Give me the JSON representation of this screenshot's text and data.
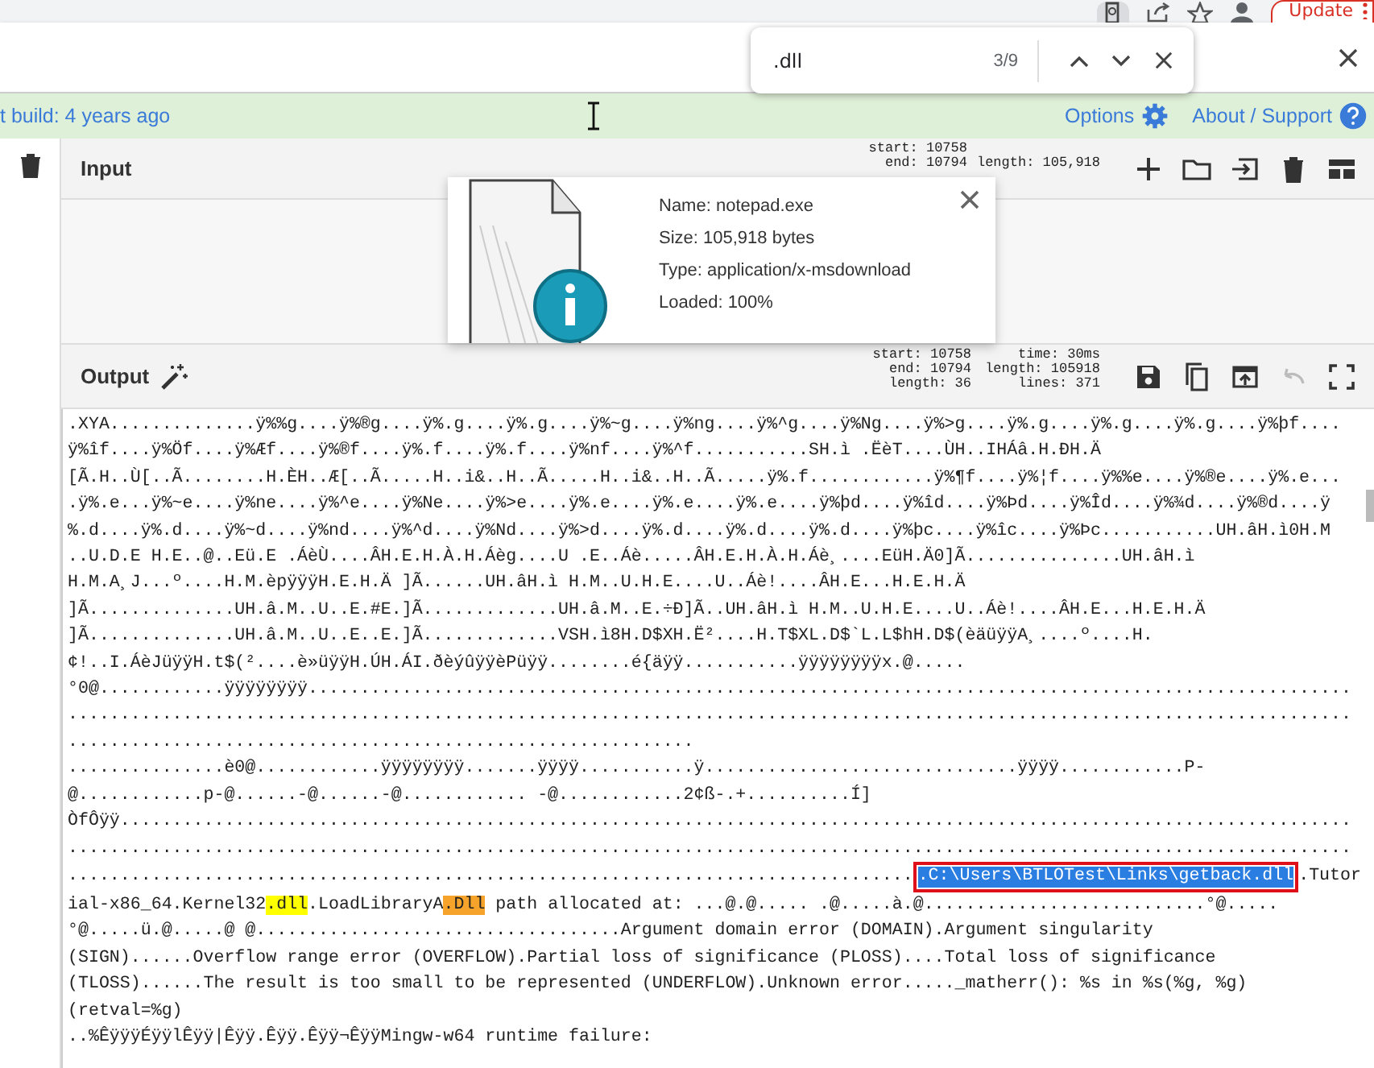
{
  "browser_toolbar": {
    "update_button": "Update"
  },
  "find_bar": {
    "query": ".dll",
    "count": "3/9"
  },
  "banner": {
    "build_text": "t build: 4 years ago",
    "options_link": "Options",
    "support_link": "About / Support"
  },
  "input": {
    "title": "Input",
    "stats_left": [
      "start: 10758",
      "end: 10794"
    ],
    "stats_right": [
      "length: 105,918"
    ]
  },
  "file_details": {
    "lines": [
      "Name: notepad.exe",
      "Size: 105,918 bytes",
      "Type: application/x-msdownload",
      "Loaded: 100%"
    ]
  },
  "output": {
    "title": "Output",
    "stats_left": [
      "start: 10758",
      "end: 10794",
      "length: 36"
    ],
    "stats_right": [
      "time: 30ms",
      "length: 105918",
      "lines: 371"
    ],
    "undo_disabled": true,
    "lines": [
      [
        {
          "text": ".XYA..............ÿ%%g....ÿ%®g....ÿ%.g....ÿ%.g....ÿ%~g....ÿ%ng....ÿ%^g....ÿ%Ng....ÿ%>g....ÿ%.g....ÿ%.g....ÿ%.g....ÿ%þf....",
          "kind": "plain"
        }
      ],
      [
        {
          "text": "ÿ%îf....ÿ%Öf....ÿ%Æf....ÿ%®f....ÿ%.f....ÿ%.f....ÿ%nf....ÿ%^f...........SH.ì .ËèT....ÙH..IHÁâ.H.ÐH.Ä",
          "kind": "plain"
        }
      ],
      [
        {
          "text": "[Ã.H..Ù[..Ã........H.ÈH..Æ[..Ã.....H..i&..H..Ã.....H..i&..H..Ã.....ÿ%.f............ÿ%¶f....ÿ%¦f....ÿ%%e....ÿ%®e....ÿ%.e...",
          "kind": "plain"
        }
      ],
      [
        {
          "text": ".ÿ%.e...ÿ%~e....ÿ%ne....ÿ%^e....ÿ%Ne....ÿ%>e....ÿ%.e....ÿ%.e....ÿ%.e....ÿ%þd....ÿ%îd....ÿ%Þd....ÿ%Îd....ÿ%¾d....ÿ%®d....ÿ",
          "kind": "plain"
        }
      ],
      [
        {
          "text": "%.d....ÿ%.d....ÿ%~d....ÿ%nd....ÿ%^d....ÿ%Nd....ÿ%>d....ÿ%.d....ÿ%.d....ÿ%.d....ÿ%þc....ÿ%îc....ÿ%Þc...........UH.âH.ì0H.M",
          "kind": "plain"
        }
      ],
      [
        {
          "text": "..U.D.E H.E..@..Eü.E .ÁèÙ....ÂH.E.H.À.H.Áèg....U .E..Áè.....ÂH.E.H.À.H.Áè¸....EüH.Ä0]Ã...............UH.âH.ì",
          "kind": "plain"
        }
      ],
      [
        {
          "text": "H.M.A¸J...º....H.M.èpÿÿÿH.E.H.Ä ]Ã......UH.âH.ì H.M..U.H.E....U..Áè!....ÂH.E...H.E.H.Ä",
          "kind": "plain"
        }
      ],
      [
        {
          "text": "]Ã..............UH.â.M..U..E.#E.]Ã.............UH.â.M..E.÷Ð]Ã..UH.âH.ì H.M..U.H.E....U..Áè!....ÂH.E...H.E.H.Ä",
          "kind": "plain"
        }
      ],
      [
        {
          "text": "]Ã..............UH.â.M..U..E..E.]Ã.............VSH.ì8H.D$XH.Ë²....H.T$XL.D$`L.L$hH.D$(èäüÿÿA¸....º....H.",
          "kind": "plain"
        }
      ],
      [
        {
          "text": "¢!..I.ÁèJüÿÿH.t$(²....è»üÿÿH.ÚH.ÁI.ðèýûÿÿèPüÿÿ........é{äÿÿ...........ÿÿÿÿÿÿÿÿx.@.....",
          "kind": "plain"
        }
      ],
      [
        {
          "text": "°0@............ÿÿÿÿÿÿÿÿ....................................................................................................",
          "kind": "plain"
        }
      ],
      [
        {
          "text": "...........................................................................................................................",
          "kind": "plain"
        }
      ],
      [
        {
          "text": "............................................................",
          "kind": "plain"
        }
      ],
      [
        {
          "text": "...............è0@............ÿÿÿÿÿÿÿÿ.......ÿÿÿÿ...........ÿ..............................ÿÿÿÿ............P-",
          "kind": "plain"
        }
      ],
      [
        {
          "text": "@............p-@......-@......-@............ -@............2¢ß-.+..........Í]",
          "kind": "plain"
        }
      ],
      [
        {
          "text": "ÒfÔÿÿ......................................................................................................................",
          "kind": "plain"
        }
      ],
      [
        {
          "text": "...........................................................................................................................",
          "kind": "plain"
        }
      ],
      [
        {
          "text": ".................................................................................",
          "kind": "plain"
        },
        {
          "text": ".C:\\Users\\BTLOTest\\Links\\getback.dll",
          "kind": "selected"
        },
        {
          "text": ".Tutor",
          "kind": "plain"
        }
      ],
      [
        {
          "text": "ial-x86_64.Kernel32",
          "kind": "plain"
        },
        {
          "text": ".dll",
          "kind": "match"
        },
        {
          "text": ".LoadLibraryA",
          "kind": "plain"
        },
        {
          "text": ".Dll",
          "kind": "current"
        },
        {
          "text": " path allocated at: ...@.@..... .@.....à.@...........................°@.....",
          "kind": "plain"
        }
      ],
      [
        {
          "text": "°@.....ü.@.....@ @...................................Argument domain error (DOMAIN).Argument singularity",
          "kind": "plain"
        }
      ],
      [
        {
          "text": "(SIGN)......Overflow range error (OVERFLOW).Partial loss of significance (PLOSS)....Total loss of significance",
          "kind": "plain"
        }
      ],
      [
        {
          "text": "(TLOSS)......The result is too small to be represented (UNDERFLOW).Unknown error....._matherr(): %s in %s(%g, %g)",
          "kind": "plain"
        }
      ],
      [
        {
          "text": "(retval=%g)",
          "kind": "plain"
        }
      ],
      [
        {
          "text": "..%ÊÿÿÿÉÿÿlÊÿÿ|Êÿÿ.Êÿÿ.Êÿÿ¬ÊÿÿMingw-w64 runtime failure:",
          "kind": "plain"
        }
      ]
    ]
  }
}
